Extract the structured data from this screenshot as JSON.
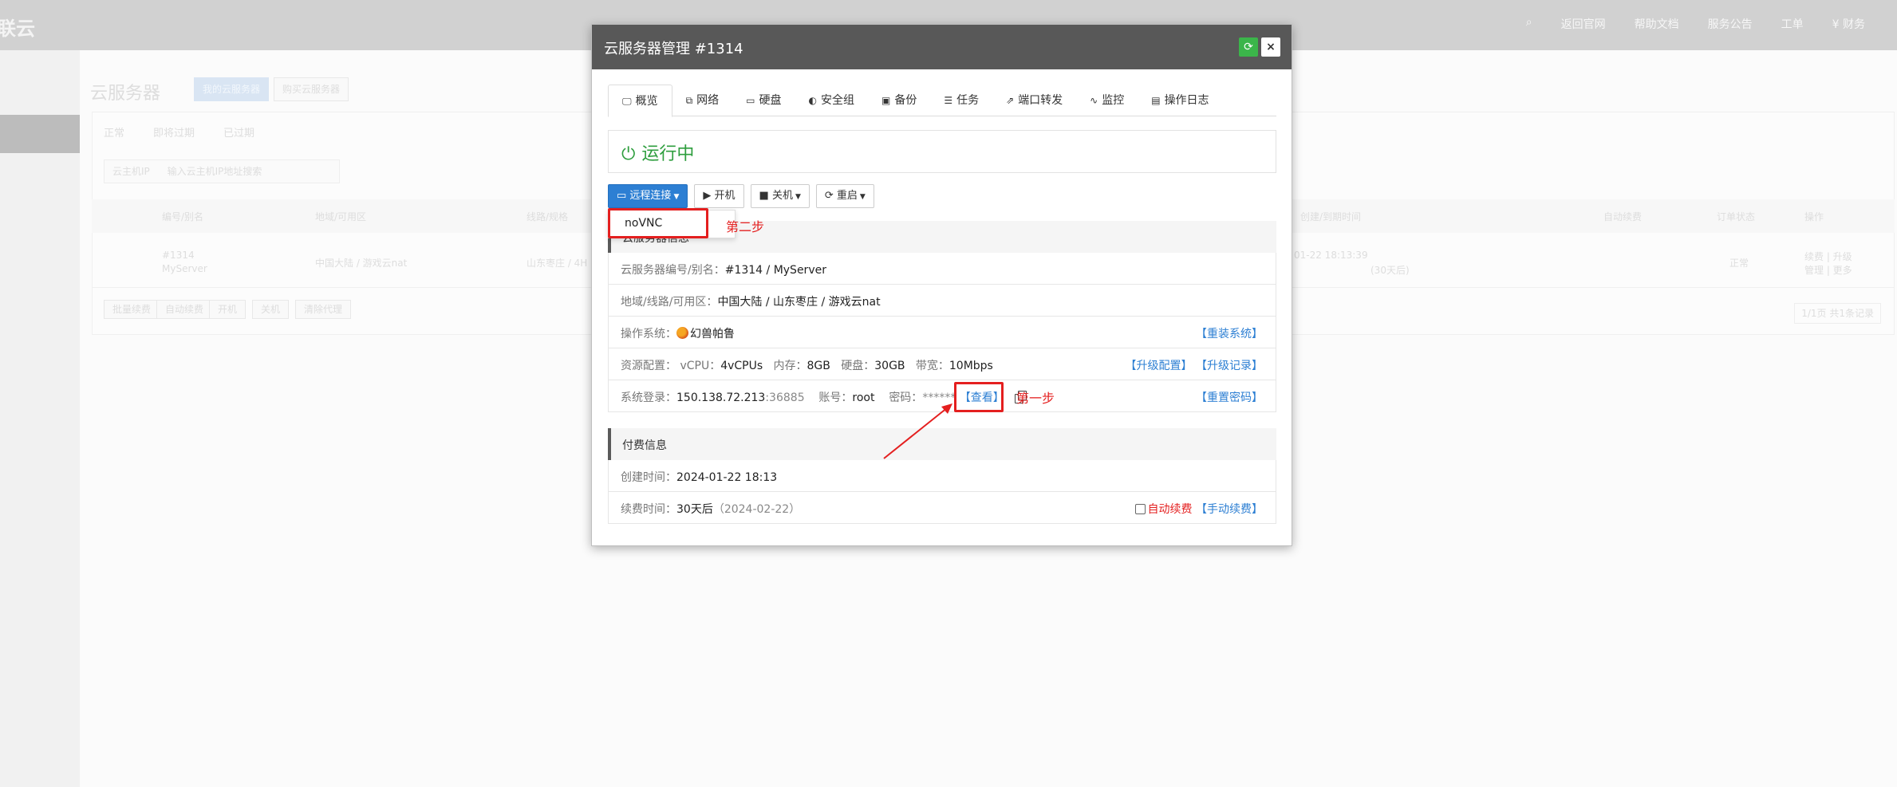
{
  "background": {
    "brand": "联云",
    "topnav": [
      "返回官网",
      "帮助文档",
      "服务公告",
      "工单",
      "¥ 财务"
    ],
    "page_title": "云服务器",
    "buttons": {
      "my_servers": "我的云服务器",
      "buy": "购买云服务器"
    },
    "filter_tabs": [
      "正常",
      "即将过期",
      "已过期"
    ],
    "search": {
      "select": "云主机IP",
      "placeholder": "输入云主机IP地址搜索"
    },
    "table_headers": [
      "编号/别名",
      "地域/可用区",
      "线路/规格",
      "创建/到期时间",
      "自动续费",
      "订单状态",
      "操作"
    ],
    "row": {
      "id": "#1314",
      "alias": "MyServer",
      "region": "中国大陆 / 游戏云nat",
      "line": "山东枣庄 / 4H",
      "time": "01-22 18:13:39",
      "days": "(30天后)",
      "status": "正常",
      "ops1": "续费 | 升级",
      "ops2": "管理 | 更多"
    },
    "bottom_buttons": [
      "批量续费",
      "自动续费",
      "开机",
      "关机",
      "清除代理"
    ],
    "pager": "1/1页 共1条记录"
  },
  "modal": {
    "title": "云服务器管理 #1314",
    "tabs": [
      {
        "icon": "monitor-icon",
        "glyph": "🖵",
        "label": "概览"
      },
      {
        "icon": "network-icon",
        "glyph": "⧉",
        "label": "网络"
      },
      {
        "icon": "disk-icon",
        "glyph": "▭",
        "label": "硬盘"
      },
      {
        "icon": "shield-icon",
        "glyph": "◐",
        "label": "安全组"
      },
      {
        "icon": "backup-icon",
        "glyph": "▣",
        "label": "备份"
      },
      {
        "icon": "task-icon",
        "glyph": "☰",
        "label": "任务"
      },
      {
        "icon": "external-link-icon",
        "glyph": "⇗",
        "label": "端口转发"
      },
      {
        "icon": "monitor-chart-icon",
        "glyph": "∿",
        "label": "监控"
      },
      {
        "icon": "log-icon",
        "glyph": "▤",
        "label": "操作日志"
      }
    ],
    "status": "运行中",
    "actions": {
      "remote": "远程连接",
      "start": "开机",
      "shutdown": "关机",
      "restart": "重启"
    },
    "dropdown": {
      "item": "noVNC"
    },
    "annotations": {
      "step2": "第二步",
      "step1": "第一步"
    },
    "info": {
      "section_title": "云服务器信息",
      "id_label": "云服务器编号/别名：",
      "id_value": "#1314 / MyServer",
      "region_label": "地域/线路/可用区：",
      "region_value": "中国大陆 / 山东枣庄 / 游戏云nat",
      "os_label": "操作系统：",
      "os_value": "幻兽帕鲁",
      "reinstall": "【重装系统】",
      "res_label": "资源配置：",
      "vcpu_label": "vCPU：",
      "vcpu": "4vCPUs",
      "mem_label": "内存：",
      "mem": "8GB",
      "disk_label": "硬盘：",
      "disk": "30GB",
      "bw_label": "带宽：",
      "bw": "10Mbps",
      "upgrade": "【升级配置】",
      "upgrade_log": "【升级记录】",
      "login_label": "系统登录：",
      "ip": "150.138.72.213",
      "port": ":36885",
      "account_label": "账号：",
      "account": "root",
      "pwd_label": "密码：",
      "pwd": "******",
      "view": "【查看】",
      "reset_pwd": "【重置密码】"
    },
    "billing": {
      "section_title": "付费信息",
      "created_label": "创建时间：",
      "created": "2024-01-22 18:13",
      "renew_label": "续费时间：",
      "renew": "30天后",
      "renew_date": "（2024-02-22）",
      "auto_renew": "自动续费",
      "manual_renew": "【手动续费】"
    }
  },
  "colors": {
    "accent": "#2d7fd3",
    "running": "#2e9e3e",
    "annotation": "#e41f1f",
    "header": "#585858"
  }
}
